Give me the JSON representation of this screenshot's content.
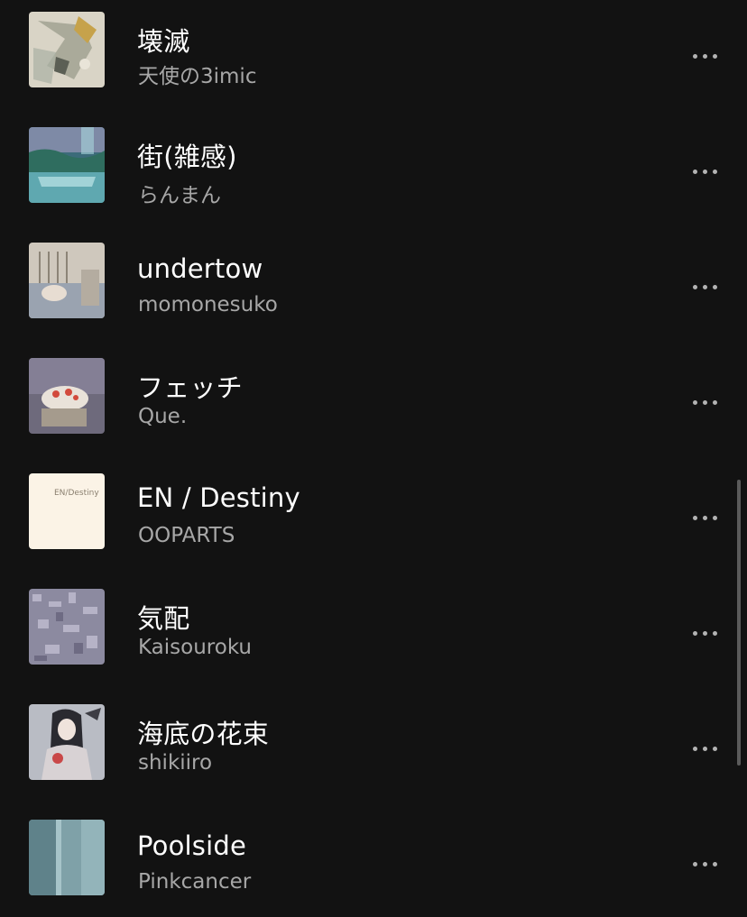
{
  "tracks": [
    {
      "title": "壊滅",
      "artist": "天使の3imic",
      "art": "art-kaimetsu"
    },
    {
      "title": "街(雑感)",
      "artist": "らんまん",
      "art": "art-machi"
    },
    {
      "title": "undertow",
      "artist": "momonesuko",
      "art": "art-undertow"
    },
    {
      "title": "フェッチ",
      "artist": "Que.",
      "art": "art-fetch"
    },
    {
      "title": "EN / Destiny",
      "artist": "OOPARTS",
      "art": "art-en-destiny",
      "art_text": "EN/Destiny"
    },
    {
      "title": "気配",
      "artist": "Kaisouroku",
      "art": "art-kehai"
    },
    {
      "title": "海底の花束",
      "artist": "shikiiro",
      "art": "art-kaitei"
    },
    {
      "title": "Poolside",
      "artist": "Pinkcancer",
      "art": "art-poolside"
    }
  ],
  "colors": {
    "background": "#121212",
    "title": "#ffffff",
    "artist": "#a7a7a7",
    "more_dots": "#b3b3b3",
    "scrollbar": "#5b5b5b"
  },
  "icons": {
    "more": "more-options-icon"
  }
}
